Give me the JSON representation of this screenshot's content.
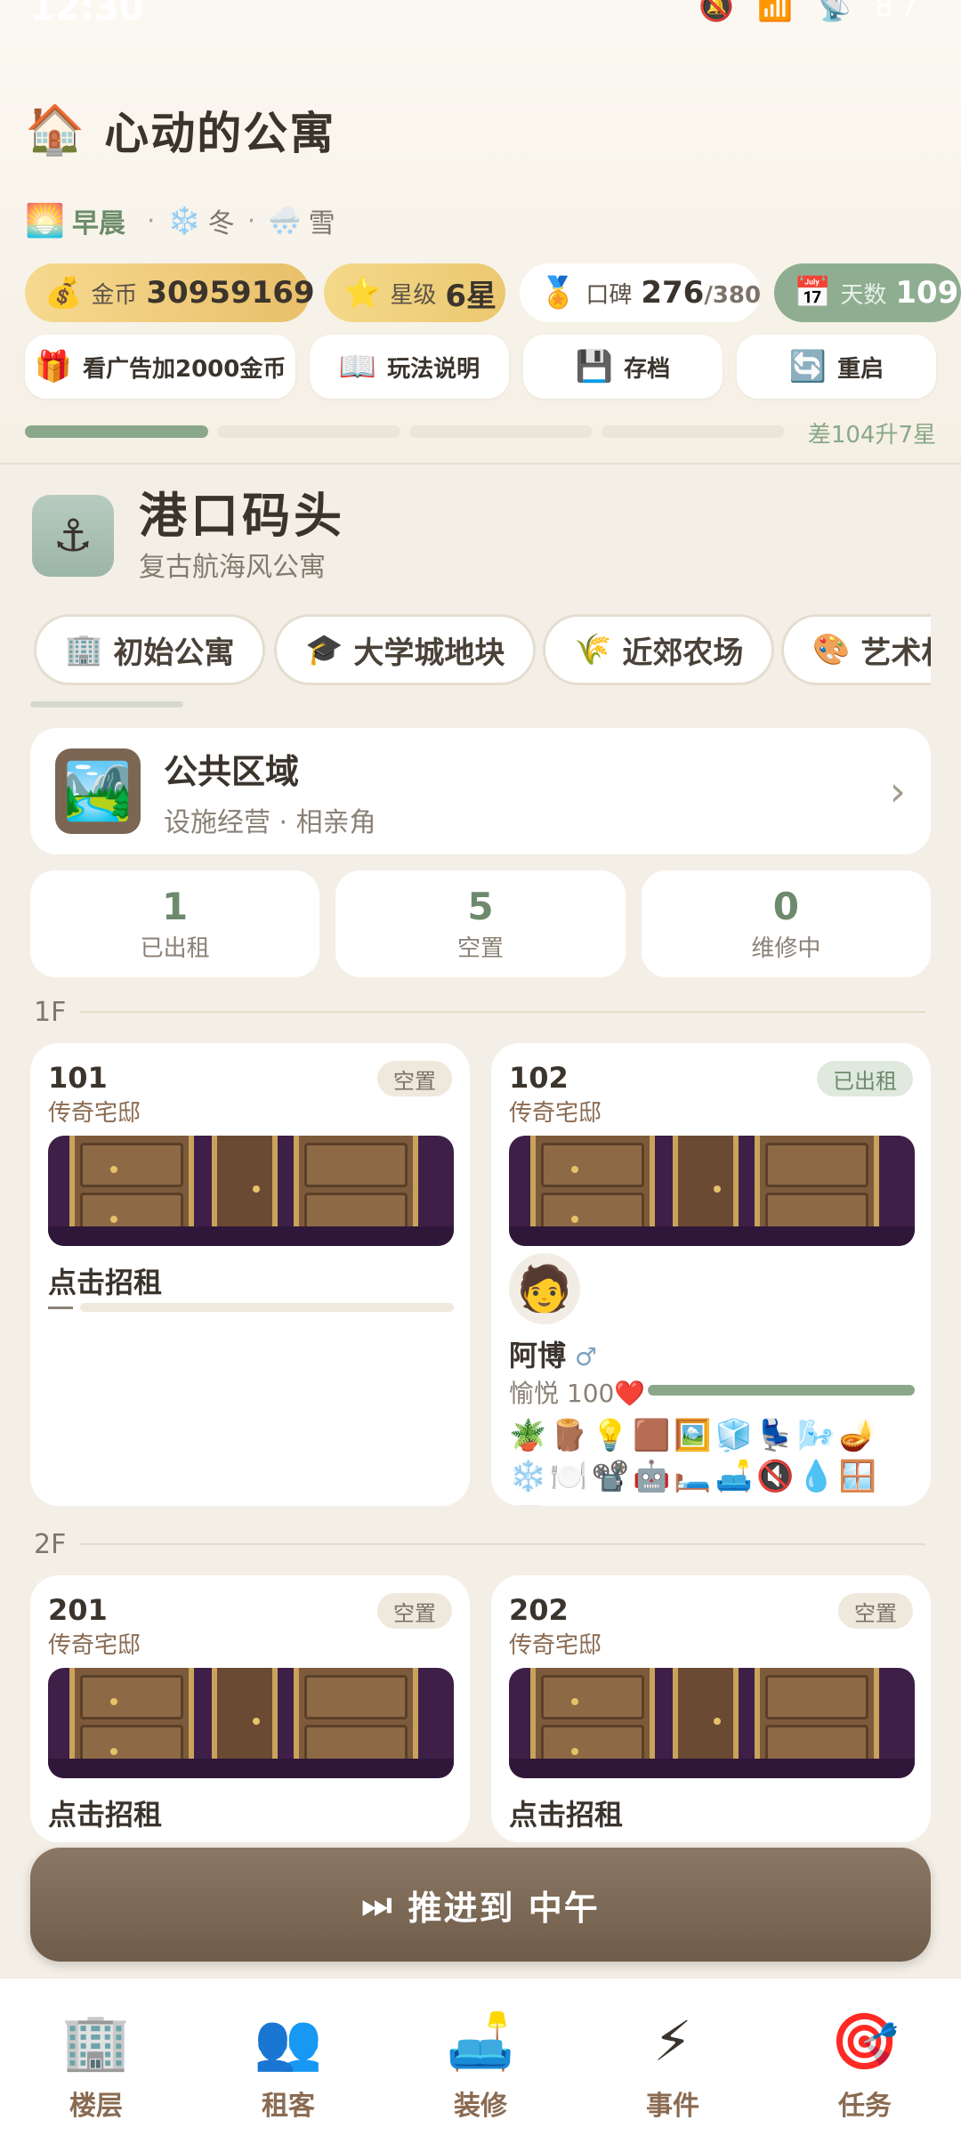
{
  "status": {
    "time": "12:30",
    "battery": "87"
  },
  "header": {
    "title": "心动的公寓",
    "title_icon": "house-icon",
    "time_of_day": "早晨",
    "season": "冬",
    "weather": "雪",
    "stats": {
      "gold_label": "金币",
      "gold_value": "30959169",
      "star_label": "星级",
      "star_value": "6星",
      "rep_label": "口碑",
      "rep_value": "276",
      "rep_max": "/380",
      "days_label": "天数",
      "days_value": "109"
    },
    "buttons": {
      "ad": "看广告加2000金币",
      "guide": "玩法说明",
      "save": "存档",
      "restart": "重启"
    },
    "progress": {
      "segments_filled": 1,
      "segments_total": 4,
      "label": "差104升7星"
    }
  },
  "harbor": {
    "name": "港口码头",
    "subtitle": "复古航海风公寓"
  },
  "chips": [
    "初始公寓",
    "大学城地块",
    "近郊农场",
    "艺术村"
  ],
  "public_area": {
    "title": "公共区域",
    "subtitle": "设施经营 · 相亲角"
  },
  "counts": [
    {
      "value": "1",
      "label": "已出租"
    },
    {
      "value": "5",
      "label": "空置"
    },
    {
      "value": "0",
      "label": "维修中"
    }
  ],
  "floors": [
    {
      "label": "1F",
      "rooms": [
        {
          "no": "101",
          "type": "传奇宅邸",
          "status": "空置",
          "cta": "点击招租"
        },
        {
          "no": "102",
          "type": "传奇宅邸",
          "status": "已出租",
          "tenant": {
            "name": "阿博",
            "gender": "♂",
            "mood": "愉悦 100❤️",
            "items": "🪴🪵💡🟫🖼️🧊💺🌬️🪔❄️🍽️📽️🤖🛏️🛋️🔇💧🪟📟"
          }
        }
      ]
    },
    {
      "label": "2F",
      "rooms": [
        {
          "no": "201",
          "type": "传奇宅邸",
          "status": "空置",
          "cta": "点击招租"
        },
        {
          "no": "202",
          "type": "传奇宅邸",
          "status": "空置",
          "cta": "点击招租"
        }
      ]
    }
  ],
  "advance_button": "推进到 中午",
  "tabs": [
    {
      "label": "楼层",
      "icon": "building-icon"
    },
    {
      "label": "租客",
      "icon": "people-icon"
    },
    {
      "label": "装修",
      "icon": "sofa-icon"
    },
    {
      "label": "事件",
      "icon": "lightning-icon"
    },
    {
      "label": "任务",
      "icon": "target-icon"
    }
  ]
}
